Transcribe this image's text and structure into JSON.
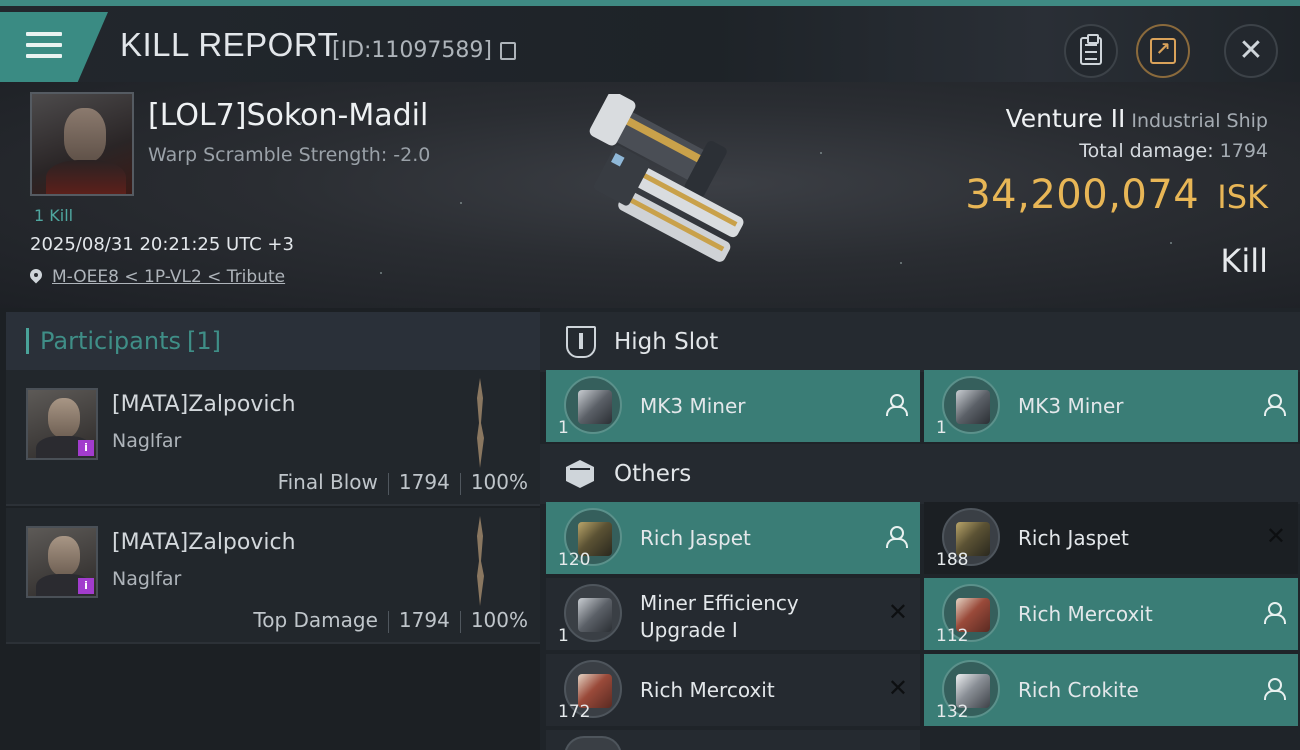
{
  "header": {
    "title": "KILL REPORT",
    "id_label": "[ID:11097589]"
  },
  "victim": {
    "name": "[LOL7]Sokon-Madil",
    "warp_scramble": "Warp Scramble Strength: -2.0",
    "kill_count": "1 Kill",
    "timestamp": "2025/08/31 20:21:25 UTC +3",
    "location": "M-OEE8 < 1P-VL2 < Tribute"
  },
  "ship": {
    "name": "Venture II",
    "class": "Industrial Ship",
    "total_damage_label": "Total damage:",
    "total_damage": "1794",
    "isk_value": "34,200,074",
    "currency": "ISK",
    "result": "Kill"
  },
  "participants": {
    "label": "Participants",
    "count": "[1]",
    "rows": [
      {
        "name": "[MATA]Zalpovich",
        "ship": "Naglfar",
        "role": "Final Blow",
        "damage": "1794",
        "percent": "100%"
      },
      {
        "name": "[MATA]Zalpovich",
        "ship": "Naglfar",
        "role": "Top Damage",
        "damage": "1794",
        "percent": "100%"
      }
    ]
  },
  "fitting": {
    "high_slot_title": "High Slot",
    "others_title": "Others",
    "high_slot": [
      {
        "qty": "1",
        "name": "MK3 Miner",
        "status": "dropped"
      },
      {
        "qty": "1",
        "name": "MK3 Miner",
        "status": "dropped"
      }
    ],
    "others": [
      {
        "qty": "120",
        "name": "Rich Jaspet",
        "status": "dropped"
      },
      {
        "qty": "188",
        "name": "Rich Jaspet",
        "status": "destroyed"
      },
      {
        "qty": "1",
        "name_line1": "Miner Efficiency",
        "name_line2": "Upgrade I",
        "status": "destroyed"
      },
      {
        "qty": "112",
        "name": "Rich Mercoxit",
        "status": "dropped"
      },
      {
        "qty": "172",
        "name": "Rich Mercoxit",
        "status": "destroyed"
      },
      {
        "qty": "132",
        "name": "Rich Crokite",
        "status": "dropped"
      }
    ]
  },
  "colors": {
    "accent": "#3a8b83",
    "isk": "#e8b656",
    "dropped": "#3a7d76",
    "destroyed": "#252a30"
  }
}
